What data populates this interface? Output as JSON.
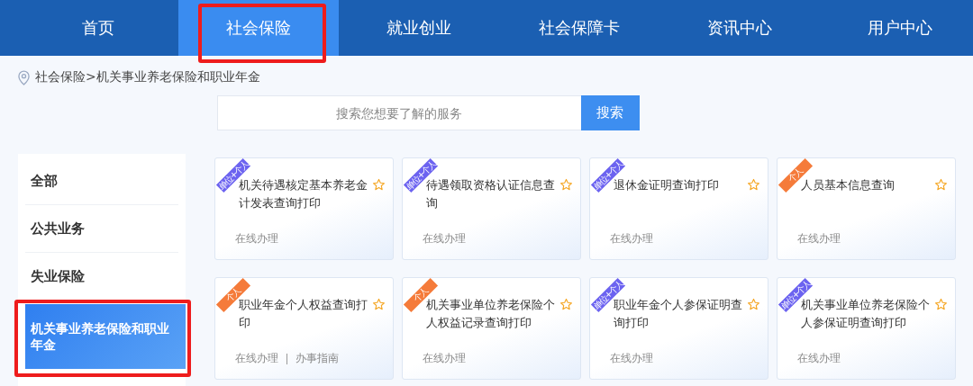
{
  "nav": [
    {
      "label": "首页",
      "selected": false,
      "annotated": false
    },
    {
      "label": "社会保险",
      "selected": true,
      "annotated": true
    },
    {
      "label": "就业创业",
      "selected": false,
      "annotated": false
    },
    {
      "label": "社会保障卡",
      "selected": false,
      "annotated": false
    },
    {
      "label": "资讯中心",
      "selected": false,
      "annotated": false
    },
    {
      "label": "用户中心",
      "selected": false,
      "annotated": false
    }
  ],
  "breadcrumb": "社会保险>机关事业养老保险和职业年金",
  "search": {
    "placeholder": "搜索您想要了解的服务",
    "button": "搜索"
  },
  "sidebar": [
    {
      "label": "全部",
      "selected": false,
      "annotated": false
    },
    {
      "label": "公共业务",
      "selected": false,
      "annotated": false
    },
    {
      "label": "失业保险",
      "selected": false,
      "annotated": false
    },
    {
      "label": "机关事业养老保险和职业年金",
      "selected": true,
      "annotated": true
    }
  ],
  "cards": [
    {
      "title": "机关待遇核定基本养老金计发表查询打印",
      "badge": {
        "kind": "unit",
        "text": "单位+个人"
      },
      "links": [
        "在线办理"
      ]
    },
    {
      "title": "待遇领取资格认证信息查询",
      "badge": {
        "kind": "unit",
        "text": "单位+个人"
      },
      "links": [
        "在线办理"
      ]
    },
    {
      "title": "退休金证明查询打印",
      "badge": {
        "kind": "unit",
        "text": "单位+个人"
      },
      "links": [
        "在线办理"
      ]
    },
    {
      "title": "人员基本信息查询",
      "badge": {
        "kind": "personal",
        "text": "个人"
      },
      "links": [
        "在线办理"
      ]
    },
    {
      "title": "职业年金个人权益查询打印",
      "badge": {
        "kind": "personal",
        "text": "个人"
      },
      "links": [
        "在线办理",
        "办事指南"
      ]
    },
    {
      "title": "机关事业单位养老保险个人权益记录查询打印",
      "badge": {
        "kind": "personal",
        "text": "个人"
      },
      "links": [
        "在线办理"
      ]
    },
    {
      "title": "职业年金个人参保证明查询打印",
      "badge": {
        "kind": "unit",
        "text": "单位+个人"
      },
      "links": [
        "在线办理"
      ]
    },
    {
      "title": "机关事业单位养老保险个人参保证明查询打印",
      "badge": {
        "kind": "unit",
        "text": "单位+个人"
      },
      "links": [
        "在线办理"
      ]
    }
  ]
}
